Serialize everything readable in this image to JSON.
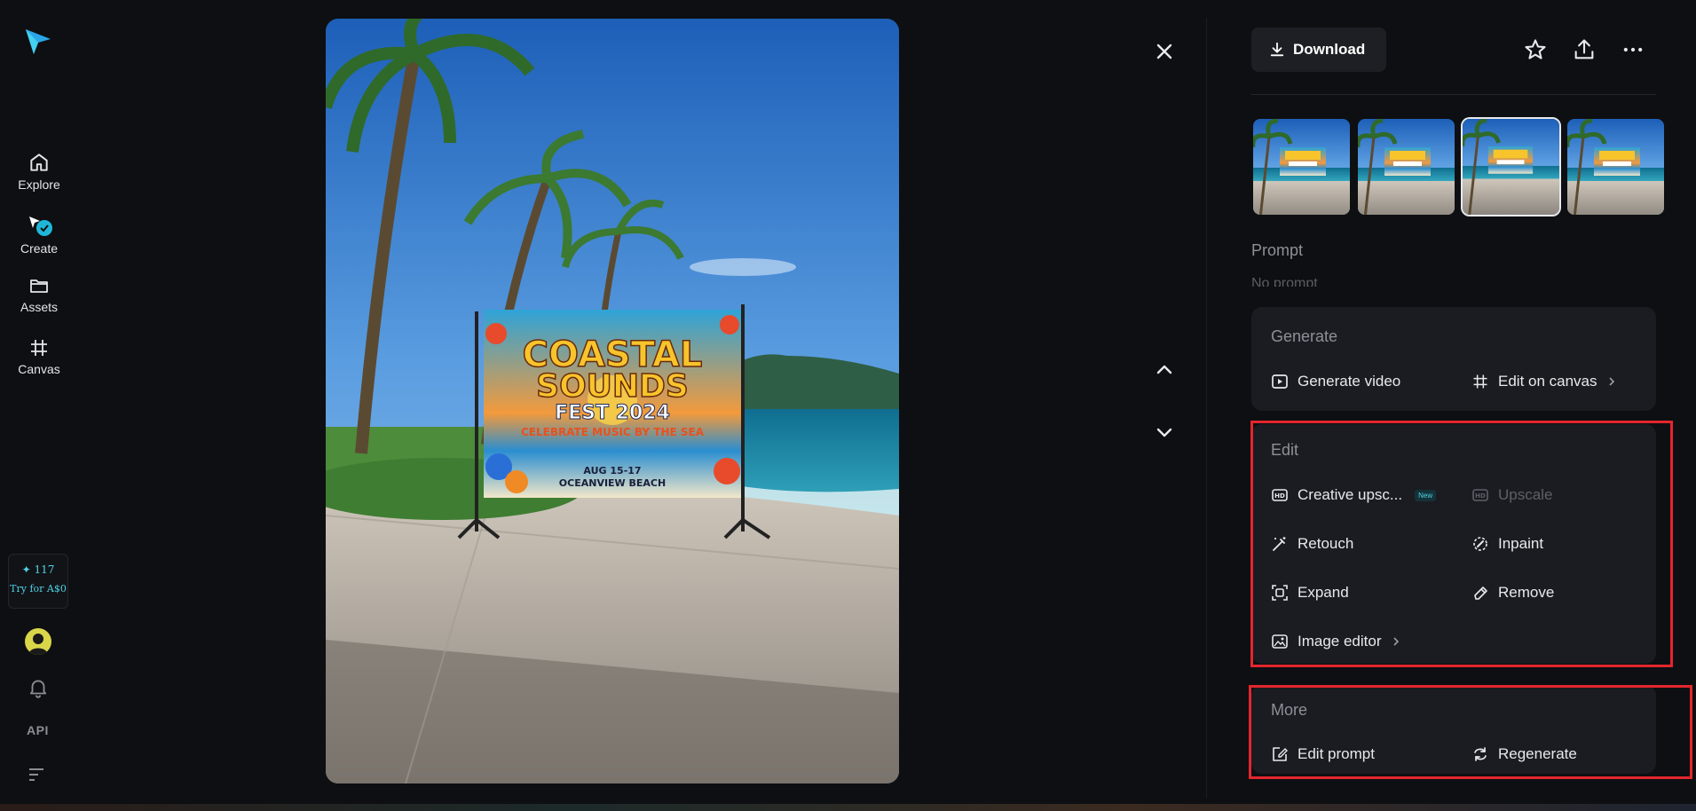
{
  "sidebar": {
    "items": [
      {
        "label": "Explore",
        "icon": "home-icon"
      },
      {
        "label": "Create",
        "icon": "create-icon"
      },
      {
        "label": "Assets",
        "icon": "folder-icon"
      },
      {
        "label": "Canvas",
        "icon": "canvas-icon"
      }
    ],
    "credits": {
      "count": "✦ 117",
      "cta": "Try for A$0"
    },
    "api_label": "API"
  },
  "viewer": {
    "banner": {
      "line1": "COASTAL",
      "line2": "SOUNDS",
      "line3": "FEST 2024",
      "tagline": "CELEBRATE MUSIC BY THE SEA",
      "dates": "AUG 15-17",
      "venue": "OCEANVIEW BEACH"
    }
  },
  "panel": {
    "download_label": "Download",
    "prompt_label": "Prompt",
    "prompt_text": "No prompt",
    "generate": {
      "title": "Generate",
      "actions": [
        "Generate video",
        "Edit on canvas"
      ]
    },
    "edit": {
      "title": "Edit",
      "creative_upscale": "Creative upsc...",
      "new_badge": "New",
      "upscale": "Upscale",
      "retouch": "Retouch",
      "inpaint": "Inpaint",
      "expand": "Expand",
      "remove": "Remove",
      "image_editor": "Image editor"
    },
    "more": {
      "title": "More",
      "edit_prompt": "Edit prompt",
      "regenerate": "Regenerate"
    }
  },
  "colors": {
    "accent": "#4fd3e6",
    "highlight": "#e3262d",
    "panel_bg": "#1b1c21"
  }
}
